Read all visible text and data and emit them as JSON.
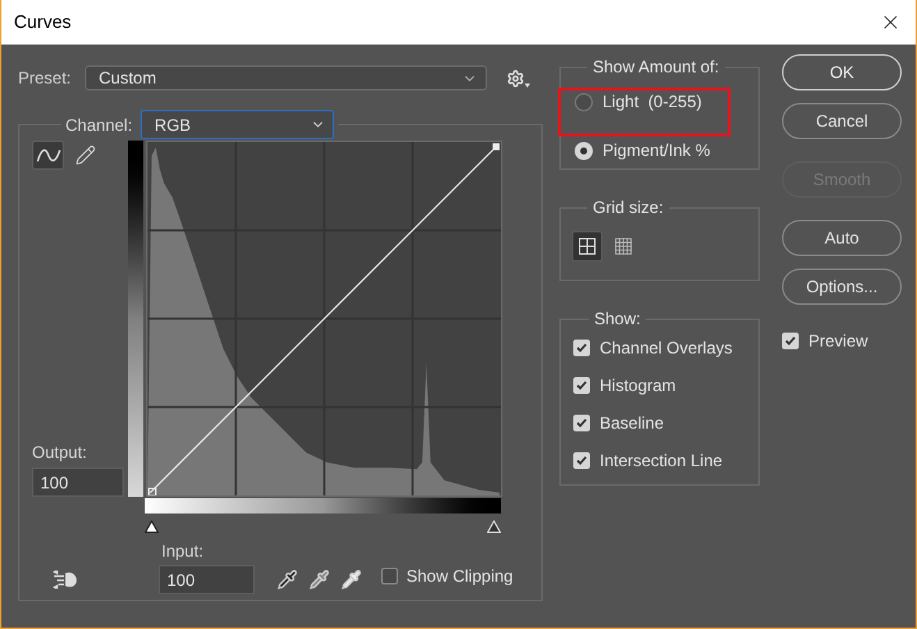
{
  "window": {
    "title": "Curves"
  },
  "preset": {
    "label": "Preset:",
    "value": "Custom"
  },
  "channel": {
    "label": "Channel:",
    "value": "RGB"
  },
  "tools": [
    {
      "kind": "curve",
      "selected": true
    },
    {
      "kind": "pencil",
      "selected": false
    }
  ],
  "output": {
    "label": "Output:",
    "value": "100"
  },
  "input": {
    "label": "Input:",
    "value": "100"
  },
  "show_clipping": {
    "label": "Show Clipping",
    "checked": false
  },
  "show_amount": {
    "title": "Show Amount of:",
    "options": [
      {
        "label": "Light  (0-255)",
        "selected": false
      },
      {
        "label": "Pigment/Ink %",
        "selected": true
      }
    ]
  },
  "grid_size": {
    "title": "Grid size:",
    "options": [
      {
        "kind": "coarse",
        "selected": true
      },
      {
        "kind": "fine",
        "selected": false
      }
    ]
  },
  "show": {
    "title": "Show:",
    "items": [
      {
        "label": "Channel Overlays",
        "checked": true
      },
      {
        "label": "Histogram",
        "checked": true
      },
      {
        "label": "Baseline",
        "checked": true
      },
      {
        "label": "Intersection Line",
        "checked": true
      }
    ]
  },
  "buttons": [
    {
      "label": "OK",
      "disabled": false
    },
    {
      "label": "Cancel",
      "disabled": false
    },
    {
      "label": "Smooth",
      "disabled": true
    },
    {
      "label": "Auto",
      "disabled": false
    },
    {
      "label": "Options...",
      "disabled": false
    }
  ],
  "preview": {
    "label": "Preview",
    "checked": true
  }
}
